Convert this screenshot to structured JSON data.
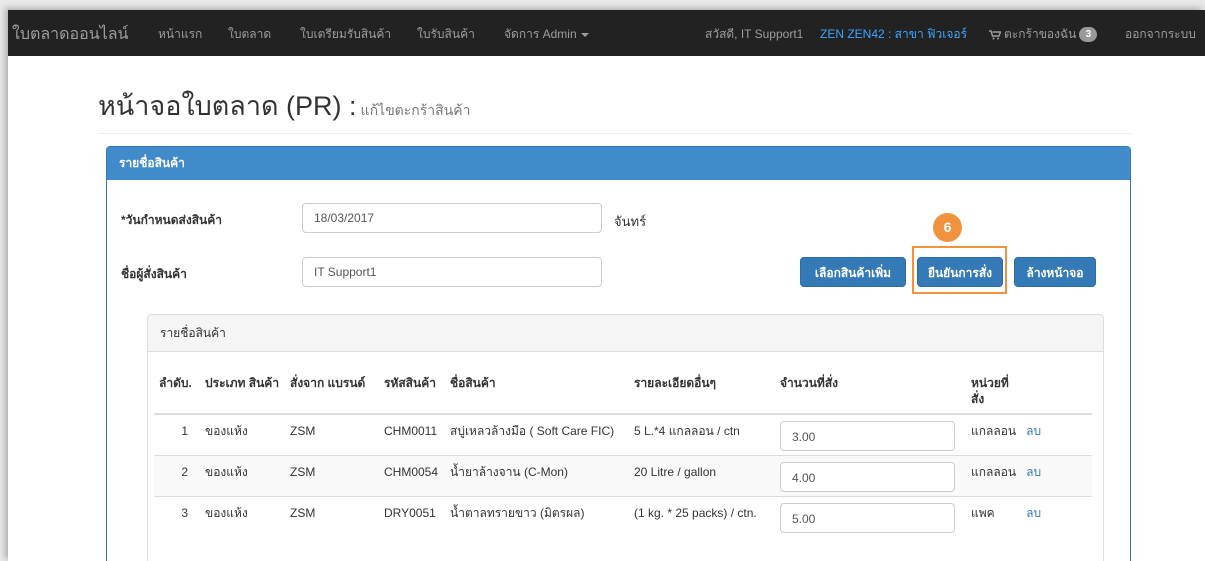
{
  "navbar": {
    "brand": "ใบตลาดออนไลน์",
    "links": [
      "หน้าแรก",
      "ใบตลาด",
      "ใบเตรียมรับสินค้า",
      "ใบรับสินค้า",
      "จัดการ Admin"
    ],
    "greeting": "สวัสดี, IT Support1",
    "branch": "ZEN ZEN42 : สาขา ฟิวเจอร์",
    "cart_label": "ตะกร้าของฉัน",
    "cart_count": "3",
    "logout": "ออกจากระบบ"
  },
  "page": {
    "title": "หน้าจอใบตลาด (PR) :",
    "subtitle": "แก้ไขตะกร้าสินค้า"
  },
  "panel": {
    "heading": "รายชื่อสินค้า",
    "delivery_label": "*วันกำหนดส่งสินค้า",
    "delivery_date": "18/03/2017",
    "delivery_day": "จันทร์",
    "orderer_label": "ชื่อผู้สั่งสินค้า",
    "orderer_name": "IT Support1",
    "btn_add": "เลือกสินค้าเพิ่ม",
    "btn_confirm": "ยืนยันการสั่ง",
    "btn_clear": "ล้างหน้าจอ",
    "step_number": "6"
  },
  "products": {
    "heading": "รายชื่อสินค้า",
    "columns": [
      "ลำดับ.",
      "ประเภท สินค้า",
      "สั่งจาก แบรนด์",
      "รหัสสินค้า",
      "ชื่อสินค้า",
      "รายละเอียดอื่นๆ",
      "จำนวนที่สั่ง",
      "หน่วยที่ สั่ง"
    ],
    "rows": [
      {
        "no": "1",
        "type": "ของแห้ง",
        "brand": "ZSM",
        "code": "CHM0011",
        "name": "สบู่เหลวล้างมือ ( Soft Care FIC)",
        "detail": "5 L.*4 แกลลอน / ctn",
        "qty": "3.00",
        "unit": "แกลลอน",
        "action": "ลบ"
      },
      {
        "no": "2",
        "type": "ของแห้ง",
        "brand": "ZSM",
        "code": "CHM0054",
        "name": "น้ำยาล้างจาน (C-Mon)",
        "detail": "20 Litre / gallon",
        "qty": "4.00",
        "unit": "แกลลอน",
        "action": "ลบ"
      },
      {
        "no": "3",
        "type": "ของแห้ง",
        "brand": "ZSM",
        "code": "DRY0051",
        "name": "น้ำตาลทรายขาว (มิตรผล)",
        "detail": "(1 kg. * 25 packs) / ctn.",
        "qty": "5.00",
        "unit": "แพค",
        "action": "ลบ"
      }
    ]
  }
}
